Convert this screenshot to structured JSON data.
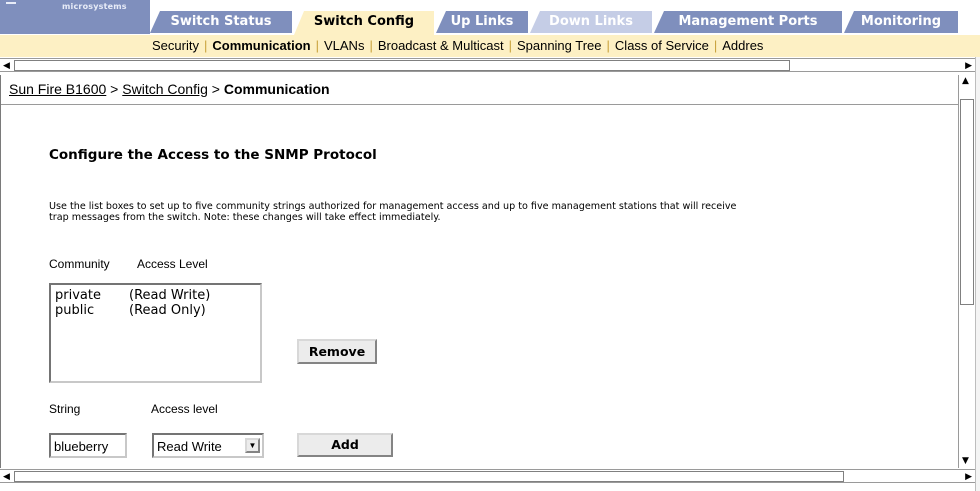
{
  "brand": {
    "text": "microsystems"
  },
  "tabs": [
    {
      "label": "Switch Status",
      "active": false
    },
    {
      "label": "Switch Config",
      "active": true
    },
    {
      "label": "Up Links",
      "active": false
    },
    {
      "label": "Down Links",
      "active": false
    },
    {
      "label": "Management Ports",
      "active": false
    },
    {
      "label": "Monitoring",
      "active": false
    }
  ],
  "subnav": [
    {
      "label": "Security",
      "active": false
    },
    {
      "label": "Communication",
      "active": true
    },
    {
      "label": "VLANs",
      "active": false
    },
    {
      "label": "Broadcast & Multicast",
      "active": false
    },
    {
      "label": "Spanning Tree",
      "active": false
    },
    {
      "label": "Class of Service",
      "active": false
    },
    {
      "label": "Addres",
      "active": false
    }
  ],
  "breadcrumb": {
    "root": "Sun Fire B1600",
    "sep1": " > ",
    "parent": "Switch Config",
    "sep2": " > ",
    "current": "Communication"
  },
  "section": {
    "title": "Configure the Access to the SNMP Protocol",
    "description": "Use the list boxes to set up to five community strings authorized for management access and up to five management stations that will receive trap messages from the switch. Note: these changes will take effect immediately."
  },
  "community": {
    "col_community": "Community",
    "col_access": "Access Level",
    "rows": [
      {
        "community": "private",
        "access": "(Read Write)"
      },
      {
        "community": "public",
        "access": "(Read Only)"
      }
    ],
    "remove_label": "Remove"
  },
  "form": {
    "string_label": "String",
    "access_label": "Access level",
    "string_value": "blueberry",
    "access_value": "Read Write",
    "add_label": "Add"
  },
  "icons": {
    "scroll_left": "left-arrow-icon",
    "scroll_right": "right-arrow-icon",
    "scroll_up": "up-arrow-icon",
    "scroll_down": "down-arrow-icon",
    "dropdown": "chevron-down-icon"
  },
  "colors": {
    "tab_bg": "#7f8fbd",
    "tab_active_bg": "#fdf0c4",
    "subnav_bg": "#fdf0c4",
    "separator": "#c9a23c"
  }
}
